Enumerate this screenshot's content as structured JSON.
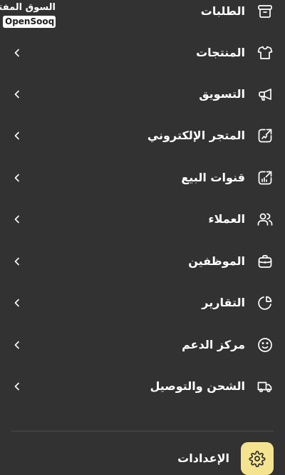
{
  "logo": {
    "arabic": "السوق المفتوح",
    "english": "OpenSooq"
  },
  "menu": {
    "items": [
      {
        "label": "الطلبات",
        "icon": "archive-box-icon",
        "chevron": false
      },
      {
        "label": "المنتجات",
        "icon": "tshirt-icon",
        "chevron": true
      },
      {
        "label": "التسويق",
        "icon": "megaphone-icon",
        "chevron": true
      },
      {
        "label": "المتجر الإلكتروني",
        "icon": "storefront-arrow-icon",
        "chevron": true
      },
      {
        "label": "قنوات البيع",
        "icon": "sales-channels-icon",
        "chevron": true
      },
      {
        "label": "العملاء",
        "icon": "users-icon",
        "chevron": true
      },
      {
        "label": "الموظفين",
        "icon": "briefcase-icon",
        "chevron": true
      },
      {
        "label": "التقارير",
        "icon": "pie-chart-icon",
        "chevron": true
      },
      {
        "label": "مركز الدعم",
        "icon": "smiley-icon",
        "chevron": true
      },
      {
        "label": "الشحن والتوصيل",
        "icon": "truck-icon",
        "chevron": true
      }
    ]
  },
  "settings": {
    "label": "الإعدادات",
    "icon": "gear-icon",
    "highlight_color": "#f5e48f"
  },
  "colors": {
    "background": "#323232",
    "text": "#ffffff",
    "divider": "#4d4d4d"
  }
}
